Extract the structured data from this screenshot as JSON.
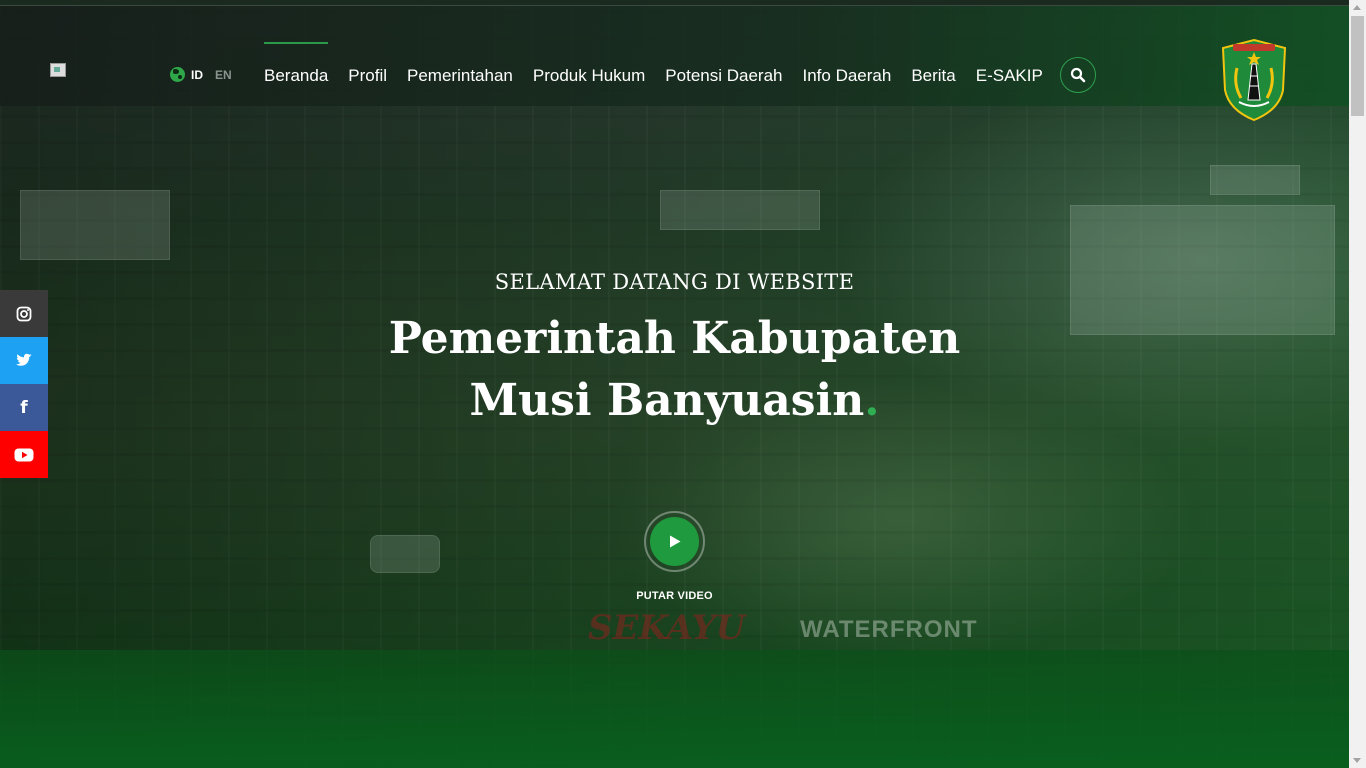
{
  "header": {
    "logo_alt": "",
    "language": {
      "icon": "globe-icon",
      "active": "ID",
      "inactive": "EN"
    },
    "nav": [
      {
        "label": "Beranda",
        "active": true
      },
      {
        "label": "Profil",
        "active": false
      },
      {
        "label": "Pemerintahan",
        "active": false
      },
      {
        "label": "Produk Hukum",
        "active": false
      },
      {
        "label": "Potensi Daerah",
        "active": false
      },
      {
        "label": "Info Daerah",
        "active": false
      },
      {
        "label": "Berita",
        "active": false
      },
      {
        "label": "E-SAKIP",
        "active": false
      }
    ],
    "search_icon": "search-icon",
    "crest_icon": "regency-crest-icon"
  },
  "social": [
    {
      "name": "instagram-icon",
      "color": "#3a3a3a"
    },
    {
      "name": "twitter-icon",
      "color": "#1da1f2"
    },
    {
      "name": "facebook-icon",
      "color": "#3b5998"
    },
    {
      "name": "youtube-icon",
      "color": "#ff0000"
    }
  ],
  "hero": {
    "welcome": "SELAMAT DATANG DI WEBSITE",
    "title_line1": "Pemerintah Kabupaten",
    "title_line2": "Musi Banyuasin",
    "title_dot": ".",
    "play_label": "PUTAR VIDEO",
    "background_sign": "WATERFRONT",
    "background_sign_red": "SEKAYU"
  },
  "colors": {
    "accent_green": "#1f9a3e",
    "nav_active_underline": "#2a9a48"
  }
}
